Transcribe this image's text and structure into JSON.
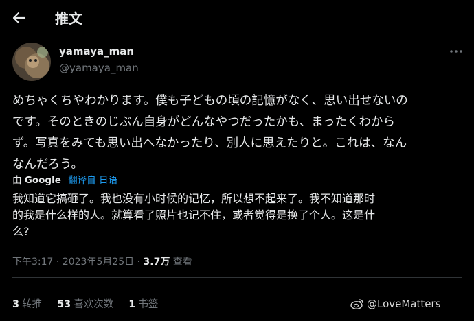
{
  "header": {
    "title": "推文",
    "back_icon": "arrow-left-icon"
  },
  "author": {
    "display_name": "yamaya_man",
    "handle": "@yamaya_man"
  },
  "tweet": {
    "text": "めちゃくちやわかります。僕も子どもの頃の記憶がなく、思い出せないの\nです。そのときのじぶん自身がどんなやつだったかも、まったくわから\nず。写真をみても思い出へなかったり、別人に思えたりと。これは、なん\nなんだろう。",
    "translate_by": "由",
    "translate_provider": "Google",
    "translate_link": "翻译自 日语",
    "translated_text": "我知道它搞砸了。我也没有小时候的记忆，所以想不起来了。我不知道那时\n的我是什么样的人。就算看了照片也记不住，或者觉得是换了个人。这是什\n么?"
  },
  "meta": {
    "time": "下午3:17",
    "date": "2023年5月25日",
    "views_count": "3.7万",
    "views_label": "查看"
  },
  "stats": {
    "retweets_count": "3",
    "retweets_label": "转推",
    "likes_count": "53",
    "likes_label": "喜欢次数",
    "bookmarks_count": "1",
    "bookmarks_label": "书签"
  },
  "watermark": {
    "text": "@LoveMatters",
    "icon": "weibo-icon"
  }
}
